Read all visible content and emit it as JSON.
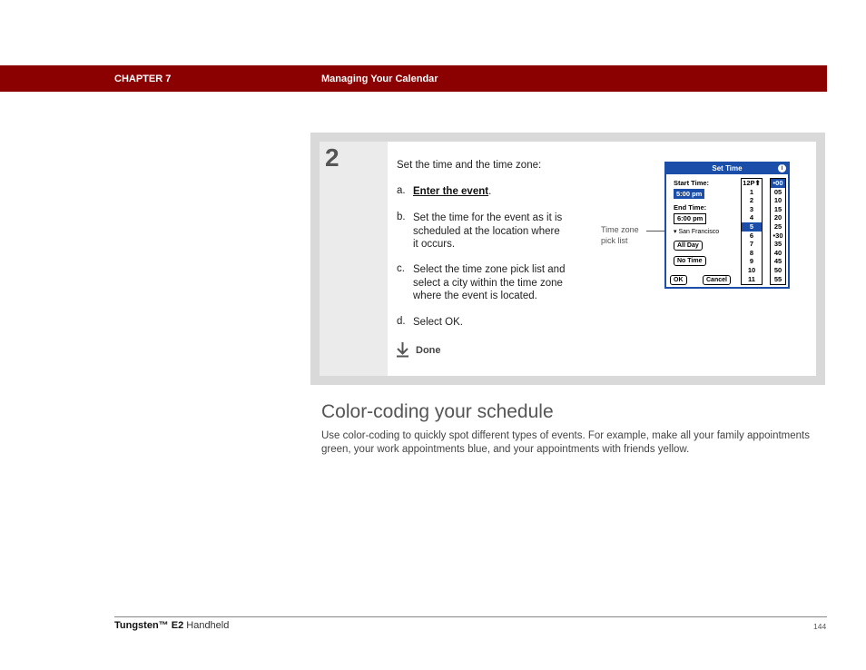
{
  "header": {
    "chapter": "CHAPTER 7",
    "section": "Managing Your Calendar",
    "bar_color": "#8b0000"
  },
  "step": {
    "number": "2",
    "intro": "Set the time and the time zone:",
    "items": [
      {
        "letter": "a.",
        "link": "Enter the event",
        "suffix": "."
      },
      {
        "letter": "b.",
        "lines": [
          "Set the time for the event as it is",
          "scheduled at the location where",
          "it occurs."
        ]
      },
      {
        "letter": "c.",
        "lines": [
          "Select the time zone pick list and",
          "select a city within the time zone",
          "where the event is located."
        ]
      },
      {
        "letter": "d.",
        "text": "Select OK."
      }
    ],
    "done_label": "Done"
  },
  "callout": {
    "line1": "Time zone",
    "line2": "pick list"
  },
  "palm_screen": {
    "title": "Set Time",
    "info_icon": "i",
    "start_label": "Start Time:",
    "start_value": "5:00 pm",
    "end_label": "End Time:",
    "end_value": "6:00 pm",
    "city": "▾ San Francisco",
    "all_day": "All Day",
    "no_time": "No Time",
    "ok": "OK",
    "cancel": "Cancel",
    "hours": [
      "12P⬆",
      "1",
      "2",
      "3",
      "4",
      "5",
      "6",
      "7",
      "8",
      "9",
      "10",
      "11"
    ],
    "selected_hour": "5",
    "minutes": [
      "•00",
      "05",
      "10",
      "15",
      "20",
      "25",
      "•30",
      "35",
      "40",
      "45",
      "50",
      "55"
    ],
    "selected_minute": "•00",
    "accent": "#1a4ea8"
  },
  "section_heading": "Color-coding your schedule",
  "section_body": "Use color-coding to quickly spot different types of events. For example, make all your family appointments green, your work appointments blue, and your appointments with friends yellow.",
  "footer": {
    "product_bold": "Tungsten™ E2",
    "product_rest": " Handheld",
    "page": "144"
  }
}
